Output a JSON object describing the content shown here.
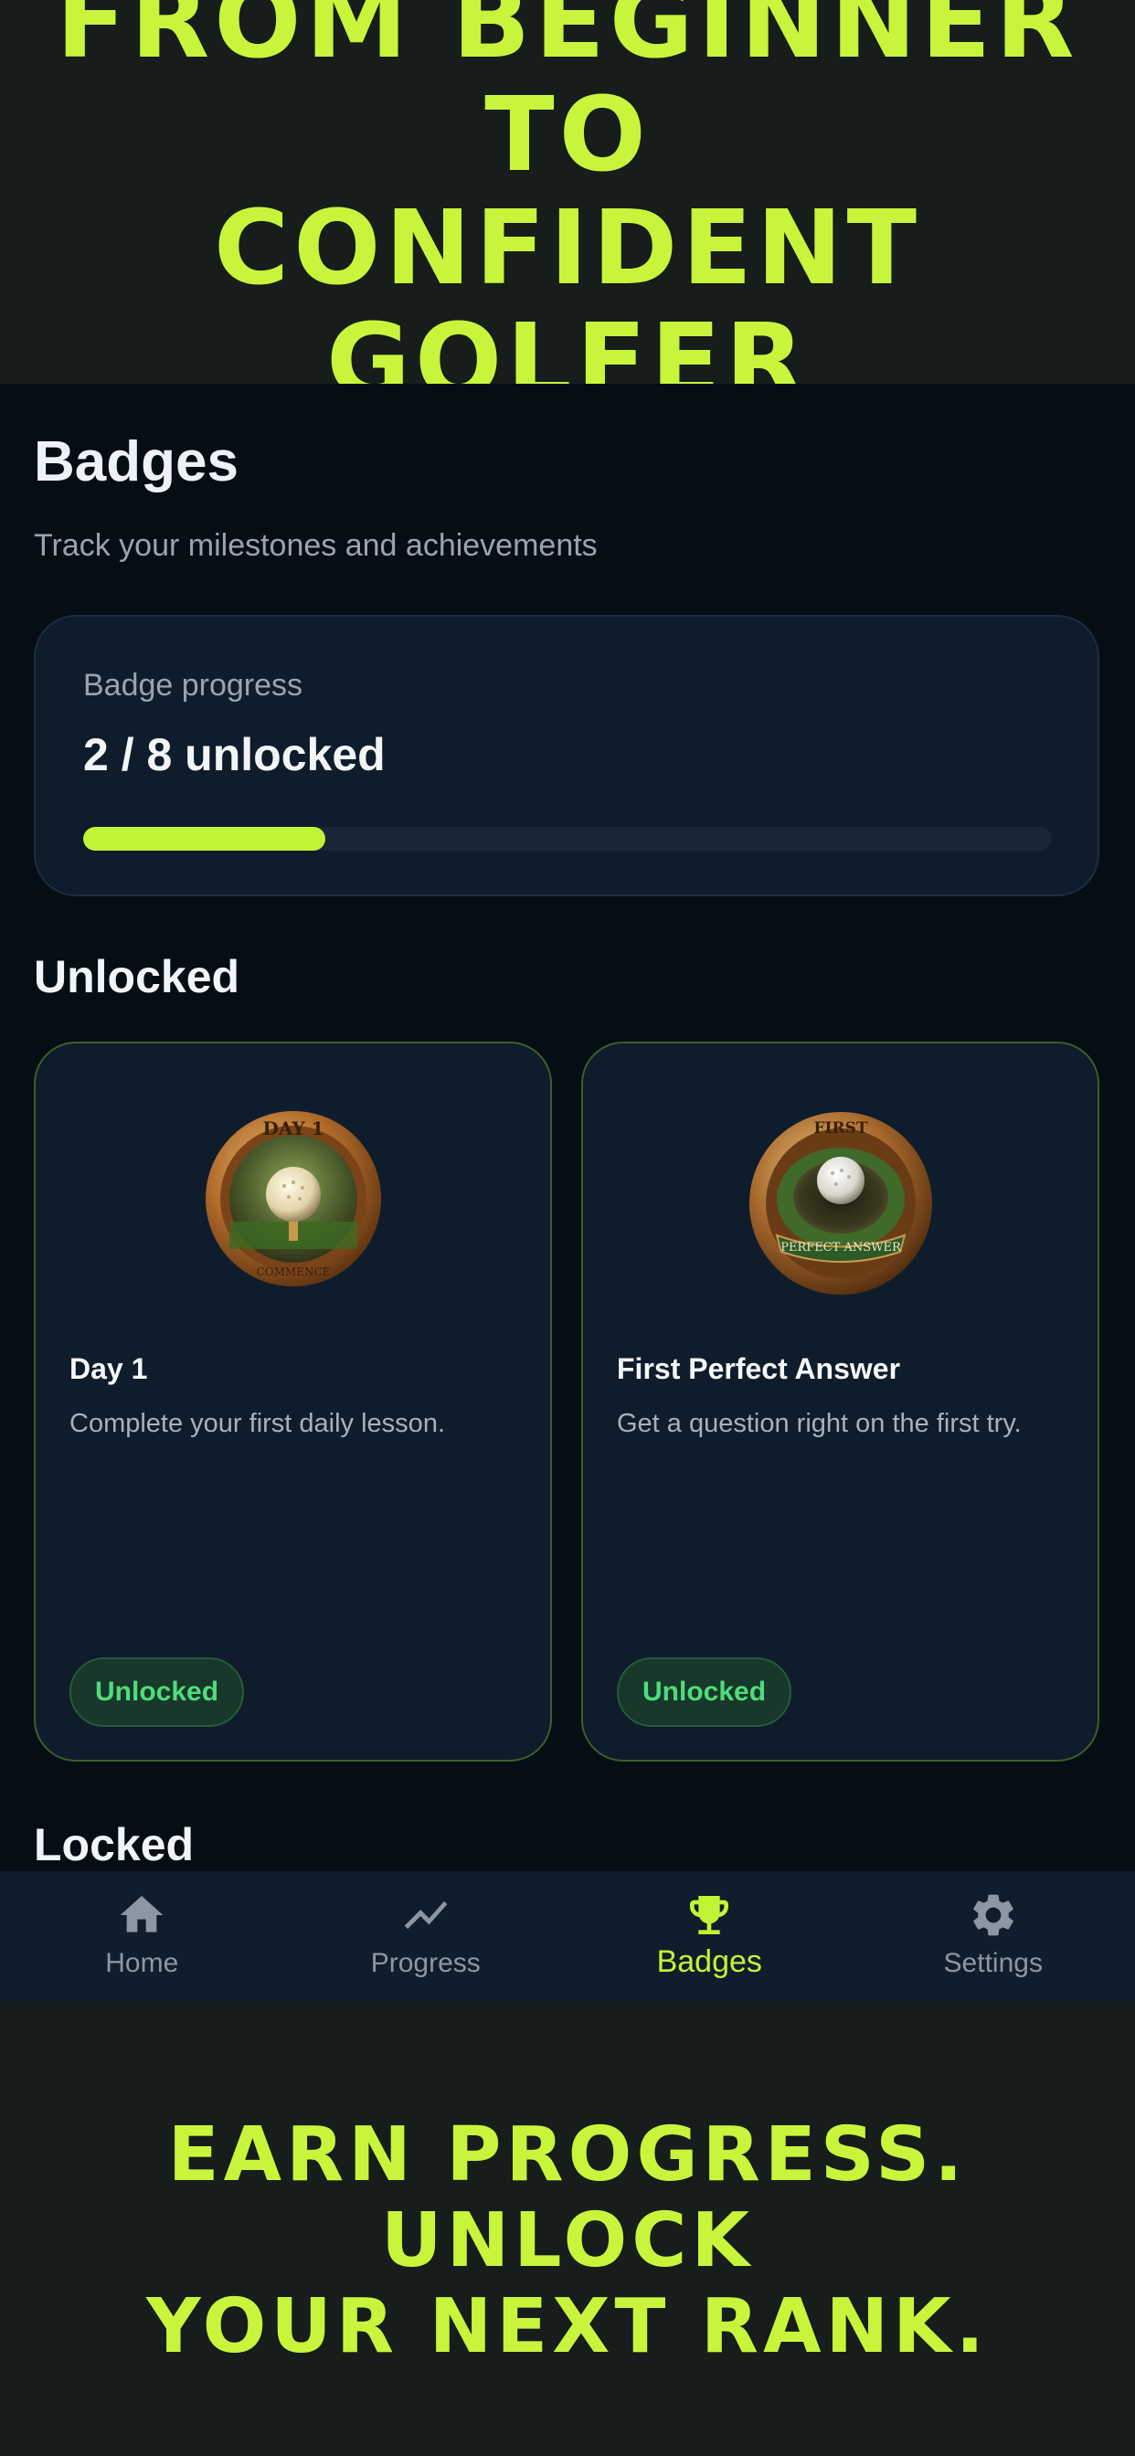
{
  "promo": {
    "headline_line1": "FROM BEGINNER TO",
    "headline_line2": "CONFIDENT GOLFER",
    "footer_line1": "EARN PROGRESS. UNLOCK",
    "footer_line2": "YOUR NEXT RANK."
  },
  "header": {
    "title": "Badges",
    "subtitle": "Track your milestones and achievements"
  },
  "progress": {
    "label": "Badge progress",
    "value_text": "2 / 8 unlocked",
    "unlocked": 2,
    "total": 8
  },
  "sections": {
    "unlocked_title": "Unlocked",
    "locked_title": "Locked"
  },
  "badges": [
    {
      "name": "Day 1",
      "description": "Complete your first daily lesson.",
      "status": "Unlocked",
      "medal_top": "DAY 1",
      "medal_bottom": "COMMENCE",
      "icon": "golf-ball-on-tee-medal-icon"
    },
    {
      "name": "First Perfect Answer",
      "description": "Get a question right on the first try.",
      "status": "Unlocked",
      "medal_top": "FIRST",
      "medal_bottom": "PERFECT ANSWER",
      "icon": "golf-ball-in-hole-medal-icon"
    }
  ],
  "nav": [
    {
      "label": "Home",
      "icon": "home-icon",
      "active": false
    },
    {
      "label": "Progress",
      "icon": "trend-icon",
      "active": false
    },
    {
      "label": "Badges",
      "icon": "trophy-icon",
      "active": true
    },
    {
      "label": "Settings",
      "icon": "gear-icon",
      "active": false
    }
  ],
  "colors": {
    "accent": "#c0f536",
    "promo_bg": "#161d1a",
    "app_bg": "#050d15",
    "card_bg": "#0f1c2b",
    "unlocked_green": "#4fdc7c"
  }
}
